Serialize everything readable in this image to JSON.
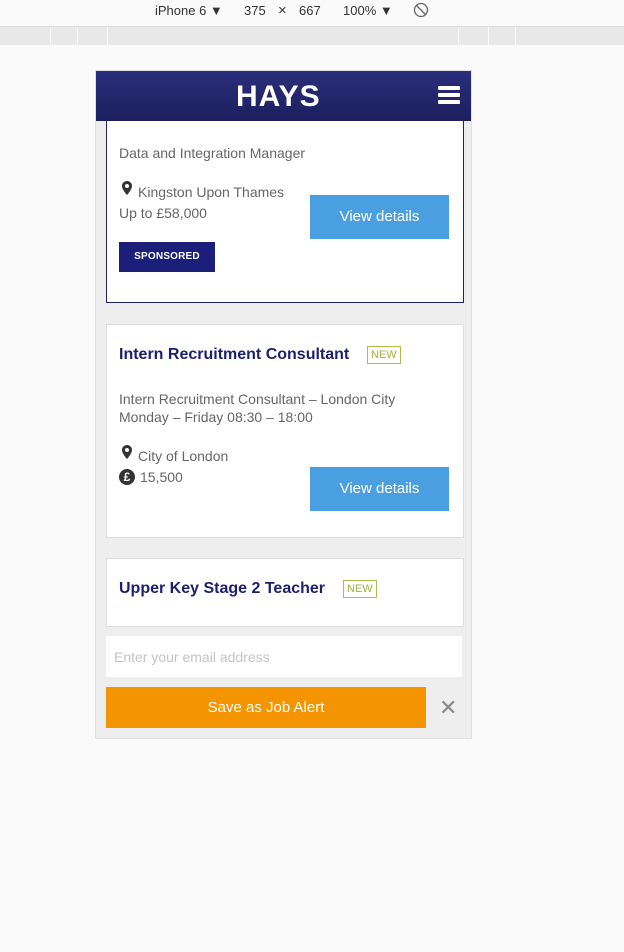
{
  "devtools": {
    "device": "iPhone 6 ▼",
    "width": "375",
    "times": "×",
    "height": "667",
    "zoom": "100% ▼",
    "rotate_icon": "rotate-icon"
  },
  "header": {
    "logo": "HAYS",
    "menu_icon": "hamburger-menu-icon"
  },
  "jobs": [
    {
      "subtitle": "Data and Integration Manager",
      "location": "Kingston Upon Thames",
      "salary": "Up to £58,000",
      "badge": "SPONSORED",
      "button": "View details"
    },
    {
      "title": "Intern Recruitment Consultant",
      "new_label": "NEW",
      "desc_line1": "Intern Recruitment Consultant – London City",
      "desc_line2": "Monday – Friday 08:30 – 18:00",
      "location": "City of London",
      "salary_symbol": "£",
      "salary": "15,500",
      "button": "View details"
    },
    {
      "title": "Upper Key Stage 2 Teacher",
      "new_label": "NEW"
    }
  ],
  "alert": {
    "email_placeholder": "Enter your email address",
    "save_label": "Save as Job Alert",
    "close_label": "✕"
  },
  "colors": {
    "brand_navy": "#1b1f6e",
    "button_blue": "#4a9fe0",
    "alert_orange": "#f39400",
    "new_green": "#9bb53a"
  }
}
